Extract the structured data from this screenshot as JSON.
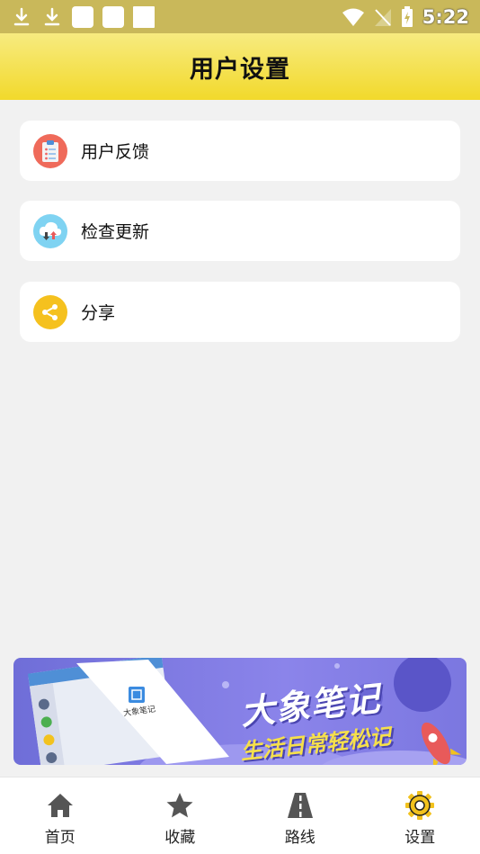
{
  "status_bar": {
    "time": "5:22"
  },
  "header": {
    "title": "用户设置"
  },
  "settings": {
    "items": [
      {
        "label": "用户反馈",
        "icon": "clipboard-icon",
        "color": "#ef6a5a"
      },
      {
        "label": "检查更新",
        "icon": "cloud-download-icon",
        "color": "#7fd3f2"
      },
      {
        "label": "分享",
        "icon": "share-icon",
        "color": "#f5c11e"
      }
    ]
  },
  "banner": {
    "title": "大象笔记",
    "subtitle": "生活日常轻松记",
    "mockup_brand": "大象笔记"
  },
  "nav": {
    "items": [
      {
        "label": "首页",
        "icon": "home-icon"
      },
      {
        "label": "收藏",
        "icon": "star-icon"
      },
      {
        "label": "路线",
        "icon": "road-icon"
      },
      {
        "label": "设置",
        "icon": "gear-icon"
      }
    ],
    "active_color": "#f2c21e"
  }
}
